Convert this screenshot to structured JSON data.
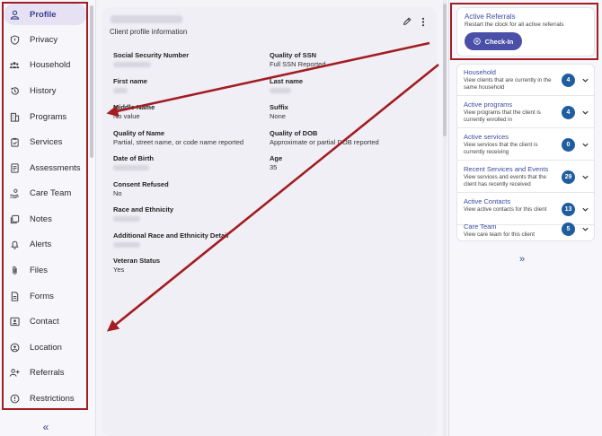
{
  "nav": {
    "items": [
      {
        "label": "Profile",
        "icon": "person-icon",
        "active": true
      },
      {
        "label": "Privacy",
        "icon": "shield-icon"
      },
      {
        "label": "Household",
        "icon": "group-icon"
      },
      {
        "label": "History",
        "icon": "history-icon"
      },
      {
        "label": "Programs",
        "icon": "building-icon"
      },
      {
        "label": "Services",
        "icon": "clipboard-icon"
      },
      {
        "label": "Assessments",
        "icon": "document-icon"
      },
      {
        "label": "Care Team",
        "icon": "care-team-icon"
      },
      {
        "label": "Notes",
        "icon": "notes-icon"
      },
      {
        "label": "Alerts",
        "icon": "bell-icon"
      },
      {
        "label": "Files",
        "icon": "paperclip-icon"
      },
      {
        "label": "Forms",
        "icon": "form-icon"
      },
      {
        "label": "Contact",
        "icon": "contact-card-icon"
      },
      {
        "label": "Location",
        "icon": "location-icon"
      },
      {
        "label": "Referrals",
        "icon": "add-person-icon"
      },
      {
        "label": "Restrictions",
        "icon": "alert-circle-icon"
      }
    ],
    "collapse_label": "«"
  },
  "profile": {
    "subtitle": "Client profile information",
    "fields": {
      "ssn": {
        "label": "Social Security Number"
      },
      "quality_ssn": {
        "label": "Quality of SSN",
        "value": "Full SSN Reported"
      },
      "first_name": {
        "label": "First name"
      },
      "last_name": {
        "label": "Last name"
      },
      "middle_name": {
        "label": "Middle Name",
        "value": "No value"
      },
      "suffix": {
        "label": "Suffix",
        "value": "None"
      },
      "quality_name": {
        "label": "Quality of Name",
        "value": "Partial, street name, or code name reported"
      },
      "quality_dob": {
        "label": "Quality of DOB",
        "value": "Approximate or partial DOB reported"
      },
      "dob": {
        "label": "Date of Birth"
      },
      "age": {
        "label": "Age",
        "value": "35"
      },
      "consent": {
        "label": "Consent Refused",
        "value": "No"
      },
      "race": {
        "label": "Race and Ethnicity"
      },
      "additional_race": {
        "label": "Additional Race and Ethnicity Detail"
      },
      "veteran": {
        "label": "Veteran Status",
        "value": "Yes"
      }
    }
  },
  "referrals": {
    "title": "Active Referrals",
    "description": "Restart the clock for all active referrals",
    "checkin_label": "Check-In"
  },
  "summary": {
    "rows": [
      {
        "title": "Household",
        "description": "View clients that are currently in the same household",
        "count": "4"
      },
      {
        "title": "Active programs",
        "description": "View programs that the client is currently enrolled in",
        "count": "4"
      },
      {
        "title": "Active services",
        "description": "View services that the client is currently receiving",
        "count": "0"
      },
      {
        "title": "Recent Services and Events",
        "description": "View services and events that the client has recently received",
        "count": "29"
      },
      {
        "title": "Active Contacts",
        "description": "View active contacts for this client",
        "count": "13"
      },
      {
        "title": "Care Team",
        "description": "View care team for this client",
        "count": "5"
      }
    ],
    "expand_label": "»"
  },
  "colors": {
    "accent": "#4a4fa8",
    "badge": "#1f5d9e",
    "annotation": "#a11d22"
  }
}
